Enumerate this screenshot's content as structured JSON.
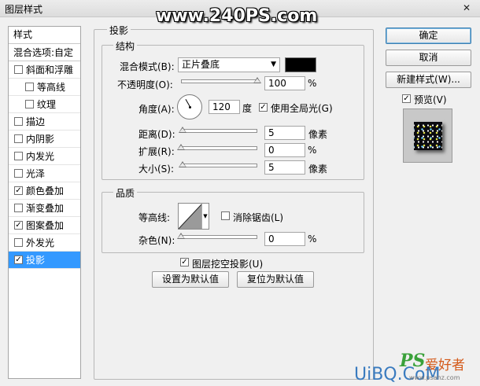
{
  "window": {
    "title": "图层样式",
    "close_glyph": "✕"
  },
  "watermark": "www.240PS.com",
  "style_list": {
    "header": "样式",
    "blend_options": "混合选项:自定",
    "items": [
      {
        "label": "斜面和浮雕",
        "checked": false,
        "indent": false,
        "selected": false
      },
      {
        "label": "等高线",
        "checked": false,
        "indent": true,
        "selected": false
      },
      {
        "label": "纹理",
        "checked": false,
        "indent": true,
        "selected": false
      },
      {
        "label": "描边",
        "checked": false,
        "indent": false,
        "selected": false
      },
      {
        "label": "内阴影",
        "checked": false,
        "indent": false,
        "selected": false
      },
      {
        "label": "内发光",
        "checked": false,
        "indent": false,
        "selected": false
      },
      {
        "label": "光泽",
        "checked": false,
        "indent": false,
        "selected": false
      },
      {
        "label": "颜色叠加",
        "checked": true,
        "indent": false,
        "selected": false
      },
      {
        "label": "渐变叠加",
        "checked": false,
        "indent": false,
        "selected": false
      },
      {
        "label": "图案叠加",
        "checked": true,
        "indent": false,
        "selected": false
      },
      {
        "label": "外发光",
        "checked": false,
        "indent": false,
        "selected": false
      },
      {
        "label": "投影",
        "checked": true,
        "indent": false,
        "selected": true
      }
    ]
  },
  "drop_shadow": {
    "group_title": "投影",
    "structure": {
      "title": "结构",
      "blend_mode_label": "混合模式(B):",
      "blend_mode_value": "正片叠底",
      "shadow_color": "#000000",
      "opacity_label": "不透明度(O):",
      "opacity_value": "100",
      "opacity_unit": "%",
      "opacity_fraction": 1.0,
      "angle_label": "角度(A):",
      "angle_value": "120",
      "angle_unit": "度",
      "use_global_light_label": "使用全局光(G)",
      "use_global_light_checked": true,
      "distance_label": "距离(D):",
      "distance_value": "5",
      "distance_unit": "像素",
      "distance_fraction": 0.02,
      "spread_label": "扩展(R):",
      "spread_value": "0",
      "spread_unit": "%",
      "spread_fraction": 0.0,
      "size_label": "大小(S):",
      "size_value": "5",
      "size_unit": "像素",
      "size_fraction": 0.02
    },
    "quality": {
      "title": "品质",
      "contour_label": "等高线:",
      "anti_alias_label": "消除锯齿(L)",
      "anti_alias_checked": false,
      "noise_label": "杂色(N):",
      "noise_value": "0",
      "noise_unit": "%",
      "noise_fraction": 0.0
    },
    "knockout_label": "图层挖空投影(U)",
    "knockout_checked": true,
    "make_default_label": "设置为默认值",
    "reset_default_label": "复位为默认值"
  },
  "buttons": {
    "ok": "确定",
    "cancel": "取消",
    "new_style": "新建样式(W)...",
    "preview_label": "预览(V)",
    "preview_checked": true
  },
  "site_logo": {
    "ps_text": "PS",
    "cn_text": "爱好者",
    "domain_text": "UiBQ.CoM",
    "small_text": "www.psahz.com"
  },
  "colors": {
    "selection": "#3399ff",
    "ok_border": "#3c7fb1"
  }
}
